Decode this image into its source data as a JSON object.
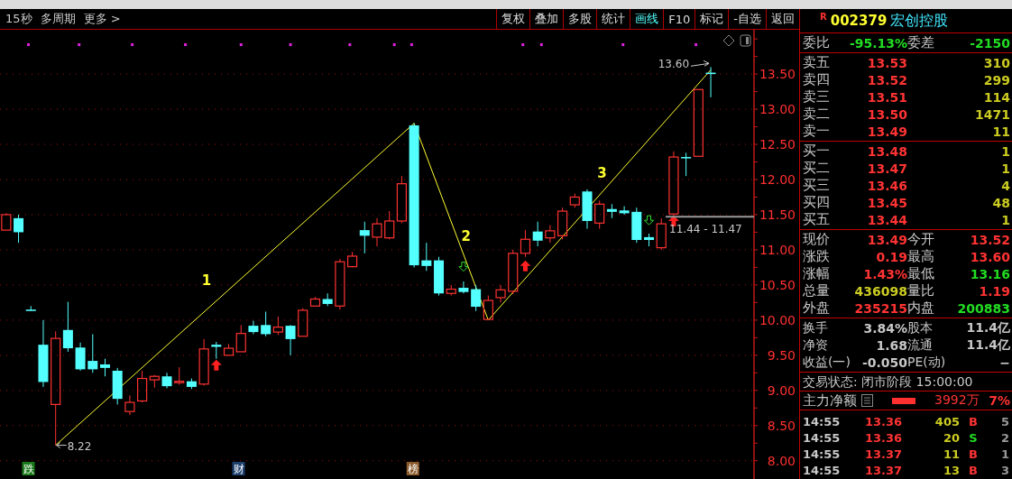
{
  "toolbar": {
    "left_items": [
      {
        "label": "15秒"
      },
      {
        "label": "多周期"
      },
      {
        "label": "更多 >"
      }
    ],
    "buttons": [
      {
        "label": "复权",
        "selected": false
      },
      {
        "label": "叠加",
        "selected": false
      },
      {
        "label": "多股",
        "selected": false
      },
      {
        "label": "统计",
        "selected": false
      },
      {
        "label": "画线",
        "selected": true
      },
      {
        "label": "F10",
        "selected": false
      },
      {
        "label": "标记",
        "selected": false
      },
      {
        "label": "-自选",
        "selected": false
      },
      {
        "label": "返回",
        "selected": false
      }
    ]
  },
  "chart": {
    "chart_data": {
      "type": "candlestick",
      "ylim": [
        7.74,
        14.13
      ],
      "grid": true,
      "yticks": [
        {
          "value": 13.5,
          "label": "13.50"
        },
        {
          "value": 13.0,
          "label": "13.00"
        },
        {
          "value": 12.5,
          "label": "12.50"
        },
        {
          "value": 12.0,
          "label": "12.00"
        },
        {
          "value": 11.5,
          "label": "11.50"
        },
        {
          "value": 11.0,
          "label": "11.00"
        },
        {
          "value": 10.5,
          "label": "10.50"
        },
        {
          "value": 10.0,
          "label": "10.00"
        },
        {
          "value": 9.5,
          "label": "9.50"
        },
        {
          "value": 9.0,
          "label": "9.00"
        },
        {
          "value": 8.5,
          "label": "8.50"
        },
        {
          "value": 8.0,
          "label": "8.00"
        }
      ],
      "categories": [
        null,
        null,
        null,
        null,
        null,
        null,
        null,
        null,
        null,
        null,
        null,
        null,
        null,
        null,
        null,
        null,
        null,
        null,
        null,
        null,
        null,
        null,
        null,
        null,
        null,
        null,
        null,
        null,
        null,
        null,
        null,
        null,
        null,
        null,
        null,
        null,
        null,
        null,
        null,
        null,
        null,
        null,
        null,
        null,
        null,
        null,
        null,
        null,
        null,
        null,
        null,
        null,
        null,
        null,
        null,
        null,
        null,
        null,
        null,
        null,
        null
      ],
      "ohlc": [
        [
          11.28,
          11.52,
          11.28,
          11.5
        ],
        [
          11.45,
          11.5,
          11.1,
          11.25
        ],
        [
          10.15,
          10.2,
          10.13,
          10.13
        ],
        [
          9.65,
          10.0,
          9.05,
          9.12
        ],
        [
          8.8,
          9.84,
          8.22,
          9.74
        ],
        [
          9.86,
          10.26,
          9.55,
          9.6
        ],
        [
          9.61,
          9.68,
          9.28,
          9.3
        ],
        [
          9.42,
          9.8,
          9.25,
          9.3
        ],
        [
          9.37,
          9.45,
          9.2,
          9.32
        ],
        [
          9.28,
          9.32,
          8.8,
          8.88
        ],
        [
          8.7,
          8.93,
          8.65,
          8.83
        ],
        [
          8.85,
          9.28,
          8.83,
          9.17
        ],
        [
          9.15,
          9.22,
          9.04,
          9.2
        ],
        [
          9.2,
          9.25,
          9.03,
          9.06
        ],
        [
          9.11,
          9.33,
          9.08,
          9.13
        ],
        [
          9.13,
          9.17,
          9.02,
          9.05
        ],
        [
          9.09,
          9.73,
          9.07,
          9.59
        ],
        [
          9.65,
          9.69,
          9.45,
          9.62
        ],
        [
          9.5,
          9.66,
          9.5,
          9.6
        ],
        [
          9.55,
          9.93,
          9.55,
          9.81
        ],
        [
          9.92,
          9.99,
          9.8,
          9.83
        ],
        [
          9.93,
          10.12,
          9.77,
          9.8
        ],
        [
          9.83,
          10.05,
          9.79,
          9.9
        ],
        [
          9.92,
          9.93,
          9.5,
          9.73
        ],
        [
          9.77,
          10.17,
          9.77,
          10.14
        ],
        [
          10.2,
          10.33,
          10.2,
          10.3
        ],
        [
          10.3,
          10.38,
          10.2,
          10.23
        ],
        [
          10.2,
          10.87,
          10.15,
          10.83
        ],
        [
          10.76,
          10.97,
          10.75,
          10.91
        ],
        [
          11.28,
          11.4,
          10.95,
          11.2
        ],
        [
          11.18,
          11.45,
          11.05,
          11.37
        ],
        [
          11.17,
          11.55,
          11.15,
          11.41
        ],
        [
          11.41,
          12.05,
          11.38,
          11.94
        ],
        [
          12.77,
          12.8,
          10.75,
          10.78
        ],
        [
          10.85,
          11.1,
          10.7,
          10.77
        ],
        [
          10.85,
          10.9,
          10.35,
          10.38
        ],
        [
          10.38,
          10.5,
          10.35,
          10.44
        ],
        [
          10.46,
          10.55,
          10.38,
          10.4
        ],
        [
          10.44,
          10.5,
          10.13,
          10.19
        ],
        [
          10.01,
          10.35,
          10.0,
          10.28
        ],
        [
          10.32,
          10.5,
          10.25,
          10.43
        ],
        [
          10.41,
          11.0,
          10.37,
          10.95
        ],
        [
          10.95,
          11.28,
          10.9,
          11.15
        ],
        [
          11.26,
          11.4,
          11.05,
          11.13
        ],
        [
          11.17,
          11.35,
          11.1,
          11.27
        ],
        [
          11.2,
          11.6,
          11.15,
          11.55
        ],
        [
          11.64,
          11.8,
          11.6,
          11.75
        ],
        [
          11.83,
          11.86,
          11.3,
          11.41
        ],
        [
          11.38,
          11.7,
          11.3,
          11.65
        ],
        [
          11.58,
          11.65,
          11.45,
          11.54
        ],
        [
          11.56,
          11.62,
          11.5,
          11.52
        ],
        [
          11.54,
          11.6,
          11.1,
          11.14
        ],
        [
          11.18,
          11.23,
          11.05,
          11.14
        ],
        [
          11.03,
          11.45,
          11.0,
          11.37
        ],
        [
          11.51,
          12.4,
          11.47,
          12.32
        ],
        [
          12.32,
          12.38,
          12.05,
          12.31
        ],
        [
          12.33,
          13.28,
          12.33,
          13.28
        ],
        [
          13.52,
          13.6,
          13.17,
          13.5
        ],
        null,
        null,
        null
      ],
      "annotations": [
        {
          "text": "1"
        },
        {
          "text": "2"
        },
        {
          "text": "3"
        },
        {
          "text": "8.22"
        },
        {
          "text": "13.60"
        },
        {
          "text": "11.44 - 11.47"
        }
      ]
    },
    "events": [
      {
        "label": "跌",
        "color": "#1a7a1a"
      },
      {
        "label": "财",
        "color": "#1c3f6e"
      },
      {
        "label": "榜",
        "color": "#8a5a2a"
      }
    ]
  },
  "quote": {
    "badge": "R",
    "code": "002379",
    "name": "宏创控股",
    "ratio": [
      {
        "label": "委比",
        "value": "-95.13%",
        "color": "#22dd22"
      },
      {
        "label": "委差",
        "value": "-2150",
        "color": "#22dd22"
      }
    ],
    "asks": [
      {
        "label": "卖五",
        "price": "13.53",
        "volume": "310"
      },
      {
        "label": "卖四",
        "price": "13.52",
        "volume": "299"
      },
      {
        "label": "卖三",
        "price": "13.51",
        "volume": "114"
      },
      {
        "label": "卖二",
        "price": "13.50",
        "volume": "1471"
      },
      {
        "label": "卖一",
        "price": "13.49",
        "volume": "11"
      }
    ],
    "bids": [
      {
        "label": "买一",
        "price": "13.48",
        "volume": "1"
      },
      {
        "label": "买二",
        "price": "13.47",
        "volume": "1"
      },
      {
        "label": "买三",
        "price": "13.46",
        "volume": "4"
      },
      {
        "label": "买四",
        "price": "13.45",
        "volume": "48"
      },
      {
        "label": "买五",
        "price": "13.44",
        "volume": "1"
      }
    ],
    "stats": [
      [
        {
          "label": "现价",
          "value": "13.49",
          "color": "#ff3333"
        },
        {
          "label": "今开",
          "value": "13.52",
          "color": "#ff3333"
        }
      ],
      [
        {
          "label": "涨跌",
          "value": "0.19",
          "color": "#ff3333"
        },
        {
          "label": "最高",
          "value": "13.60",
          "color": "#ff3333"
        }
      ],
      [
        {
          "label": "涨幅",
          "value": "1.43%",
          "color": "#ff3333"
        },
        {
          "label": "最低",
          "value": "13.16",
          "color": "#22dd22"
        }
      ],
      [
        {
          "label": "总量",
          "value": "436098",
          "color": "#cccc22"
        },
        {
          "label": "量比",
          "value": "1.19",
          "color": "#ff3333"
        }
      ],
      [
        {
          "label": "外盘",
          "value": "235215",
          "color": "#ff3333"
        },
        {
          "label": "内盘",
          "value": "200883",
          "color": "#22dd22"
        }
      ]
    ],
    "fundamentals": [
      [
        {
          "label": "换手",
          "value": "3.84%"
        },
        {
          "label": "股本",
          "value": "11.4亿"
        }
      ],
      [
        {
          "label": "净资",
          "value": "1.68"
        },
        {
          "label": "流通",
          "value": "11.4亿"
        }
      ],
      [
        {
          "label": "收益(一)",
          "value": "-0.050"
        },
        {
          "label": "PE(动)",
          "value": "−"
        }
      ]
    ],
    "status": "交易状态: 闭市阶段 15:00:00",
    "main_force": {
      "label": "主力净额",
      "value": "3992万",
      "percent": "7%"
    },
    "ticks": [
      {
        "time": "14:55",
        "price": "13.36",
        "volume": "405",
        "side": "B",
        "color": "#ff3333",
        "count": "5"
      },
      {
        "time": "14:55",
        "price": "13.36",
        "volume": "20",
        "side": "S",
        "color": "#22dd22",
        "count": "2"
      },
      {
        "time": "14:55",
        "price": "13.37",
        "volume": "11",
        "side": "B",
        "color": "#ff3333",
        "count": "1"
      },
      {
        "time": "14:55",
        "price": "13.37",
        "volume": "13",
        "side": "B",
        "color": "#ff3333",
        "count": "3"
      }
    ]
  }
}
